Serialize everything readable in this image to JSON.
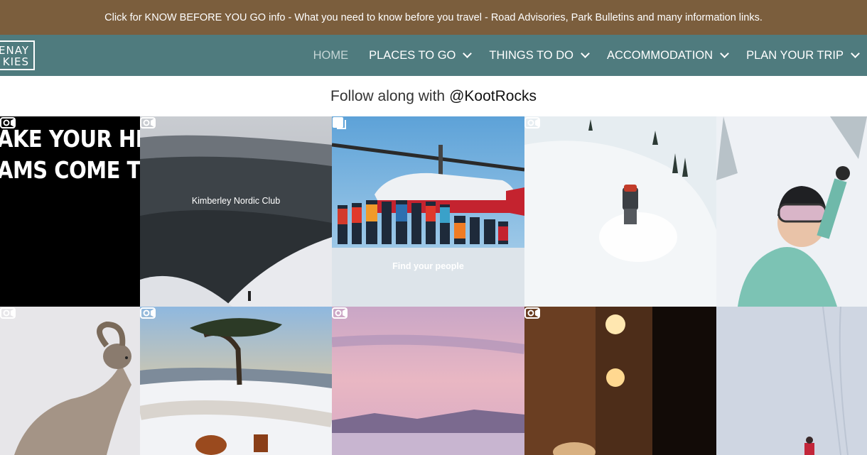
{
  "banner": {
    "text": "Click for KNOW BEFORE YOU GO info - What you need to know before you travel - Road Advisories, Park Bulletins and many information links."
  },
  "logo": {
    "line1": "ENAY",
    "line2": "KIES"
  },
  "nav": {
    "items": [
      {
        "label": "HOME",
        "active": true
      },
      {
        "label": "PLACES TO GO"
      },
      {
        "label": "THINGS TO DO"
      },
      {
        "label": "ACCOMMODATION"
      },
      {
        "label": "PLAN YOUR TRIP"
      }
    ]
  },
  "follow": {
    "prefix": "Follow along with",
    "handle": "@KootRocks"
  },
  "tiles": {
    "t1": {
      "line1": "AKE YOUR HELI",
      "line2": "AMS COME TRUE.",
      "badge": "video-camera-icon"
    },
    "t2": {
      "caption": "Kimberley Nordic Club",
      "badge": "video-camera-icon"
    },
    "t3": {
      "caption": "Find your people",
      "badge": "carousel-icon"
    },
    "t4": {
      "badge": "video-camera-icon"
    },
    "t5": {},
    "t6": {
      "badge": "video-camera-icon"
    },
    "t7": {
      "badge": "video-camera-icon"
    },
    "t8": {
      "badge": "video-camera-icon"
    },
    "t9": {
      "badge": "video-camera-icon"
    },
    "t10": {}
  },
  "colors": {
    "banner": "#7b5e3d",
    "nav": "#4f7b7e",
    "white": "#ffffff"
  }
}
